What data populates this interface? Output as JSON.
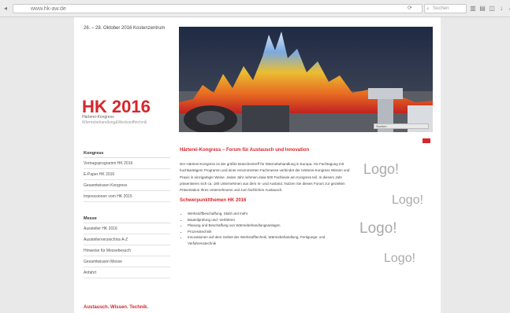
{
  "browser": {
    "url": "www.hk-aw.de",
    "search_placeholder": "Suchen",
    "toolbar_icons": [
      "library-icon",
      "sidebar-icon",
      "pocket-icon",
      "download-icon",
      "home-icon",
      "share-icon",
      "menu-icon"
    ]
  },
  "header": {
    "date": "26. – 28. Oktober 2016 Kostenzentrum",
    "title": "HK 2016",
    "subtitle": "Härterei-Kongress",
    "subtitle2": "Wärmebehandlung&Werkstofftechnik",
    "banner_caption": "Suchen"
  },
  "sidenav": {
    "section1": "Kongress",
    "items1": [
      "Vortragsprogramm HK 2016",
      "E-Paper HK 2016",
      "Gesamtwissen Kongress",
      "Impressionen vom HK 2015"
    ],
    "section2": "Messe",
    "items2": [
      "Aussteller HK 2016",
      "Ausstellerverzeichnis A-Z",
      "Hinweise für Messebesuch",
      "Gesamtwissen Messe",
      "Anfahrt"
    ],
    "footer_heading": "Austausch. Wissen. Technik."
  },
  "content": {
    "heading": "Härterei-Kongress – Forum für Austausch und Innovation",
    "body": "Der Härterei-Kongress ist der größte Branchentreff für Wärmebehandlung in Europa. Als Fachtagung mit hochkarätigem Programm und einer renommierten Fachmesse verbindet der Härterei-Kongress Wissen und Praxis in einzigartiger Weise. Jedes Jahr nehmen etwa 500 Fachleute am Kongress teil. In diesem Jahr präsentieren sich ca. 180 Unternehmen aus dem In- und Ausland. Nutzen Sie dieses Forum zur gezielten Präsentation Ihres Unternehmens und zum fachlichen Austausch.",
    "heading2": "Schwerpunktthemen HK 2016",
    "topics": [
      "Werkstoffbeschaffung, Stahl und mehr",
      "Bauteilprüfung und -Verfahren",
      "Planung und Beschaffung von Wärmebehandlungsanlagen",
      "Prozesstechnik",
      "Innovationen auf dem Gebiet der Werkstofftechnik, Wärmebehandlung, Fertigungs- und Verfahrenstechnik"
    ]
  },
  "overlay": {
    "logos": [
      "Logo!",
      "Logo!",
      "Logo!",
      "Logo!"
    ]
  },
  "colors": {
    "accent": "#d7262c",
    "logo_gray": "#aaaaaa"
  }
}
